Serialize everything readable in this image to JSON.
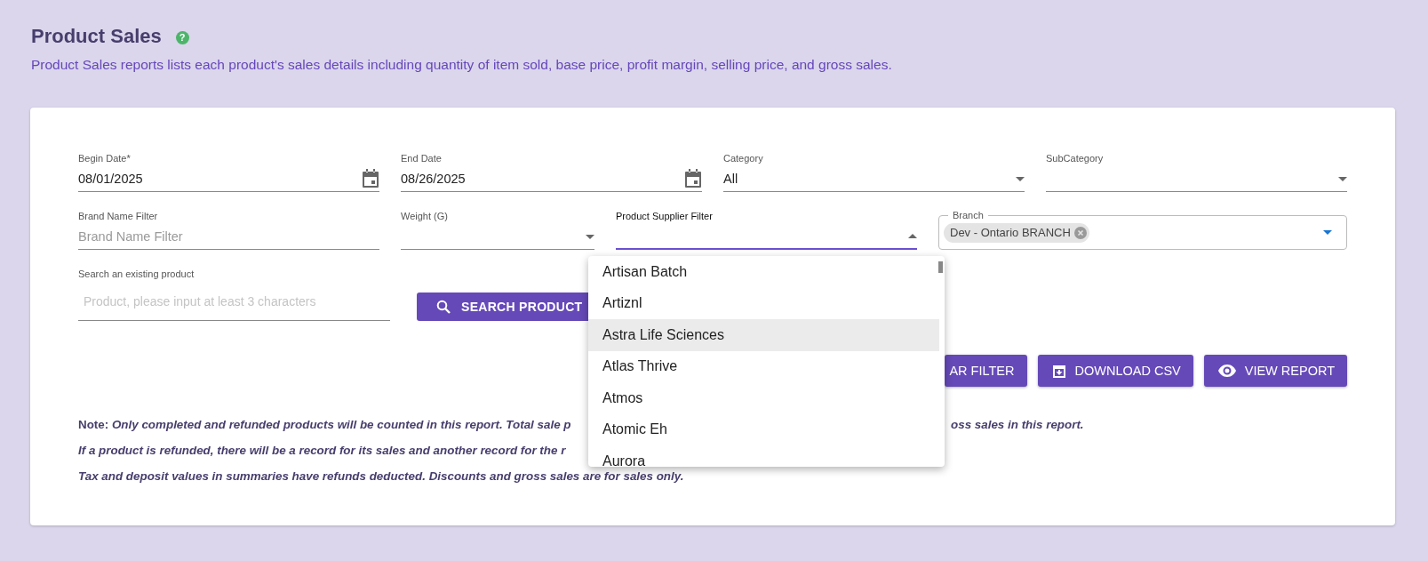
{
  "header": {
    "title": "Product Sales",
    "help_icon": "?",
    "description": "Product Sales reports lists each product's sales details including quantity of item sold, base price, profit margin, selling price, and gross sales."
  },
  "filters": [
    {
      "kind": "date",
      "label": "Begin Date*",
      "value": "08/01/2025"
    },
    {
      "kind": "date",
      "label": "End Date",
      "value": "08/26/2025"
    },
    {
      "kind": "select",
      "label": "Category",
      "value": "All",
      "expanded": false
    },
    {
      "kind": "select",
      "label": "SubCategory",
      "expanded": false
    },
    {
      "kind": "text",
      "label": "Brand Name Filter",
      "placeholder": "Brand Name Filter"
    },
    {
      "kind": "select",
      "label": "Weight (G)",
      "expanded": false
    },
    {
      "kind": "select",
      "label": "Product Supplier Filter",
      "expanded": true
    },
    {
      "kind": "chips",
      "label": "Branch",
      "chips": [
        "Dev - Ontario BRANCH"
      ]
    }
  ],
  "product_search": {
    "label": "Search an existing product",
    "placeholder": "Product, please input at least 3 characters",
    "button": "SEARCH PRODUCT"
  },
  "actions": [
    {
      "kind": "clear",
      "label": "AR FILTER"
    },
    {
      "kind": "download",
      "label": "DOWNLOAD CSV"
    },
    {
      "kind": "view",
      "label": "VIEW REPORT"
    }
  ],
  "note": [
    {
      "text": "Note: *Only completed and refunded products will be counted in this report. Total sale p*",
      "text_after_menu": "oss sales in this report."
    },
    {
      "text": "*If a product is refunded, there will be a record for its sales and another record for the r*"
    },
    {
      "text": "*Tax and deposit values in summaries have refunds deducted. Discounts and gross sales are for sales only.*"
    }
  ],
  "supplier_menu": {
    "items": [
      {
        "label": "Artisan Batch",
        "highlighted": false
      },
      {
        "label": "Artiznl",
        "highlighted": false
      },
      {
        "label": "Astra Life Sciences",
        "highlighted": true
      },
      {
        "label": "Atlas Thrive",
        "highlighted": false
      },
      {
        "label": "Atmos",
        "highlighted": false
      },
      {
        "label": "Atomic Eh",
        "highlighted": false
      },
      {
        "label": "Aurora",
        "highlighted": false
      }
    ]
  }
}
